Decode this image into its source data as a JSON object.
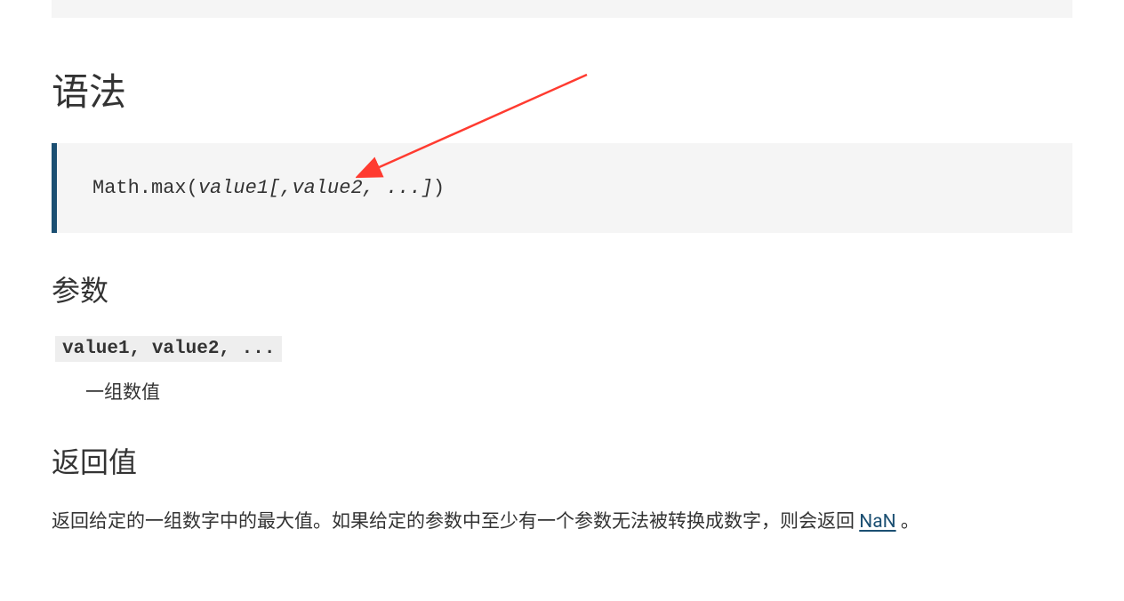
{
  "syntax": {
    "heading": "语法",
    "code_prefix": "Math.max(",
    "code_params": "value1[,value2, ...]",
    "code_suffix": ")"
  },
  "params": {
    "heading": "参数",
    "name": "value1, value2, ...",
    "desc": "一组数值"
  },
  "return": {
    "heading": "返回值",
    "desc_before": "返回给定的一组数字中的最大值。如果给定的参数中至少有一个参数无法被转换成数字，则会返回 ",
    "link": "NaN",
    "desc_after": " 。"
  }
}
